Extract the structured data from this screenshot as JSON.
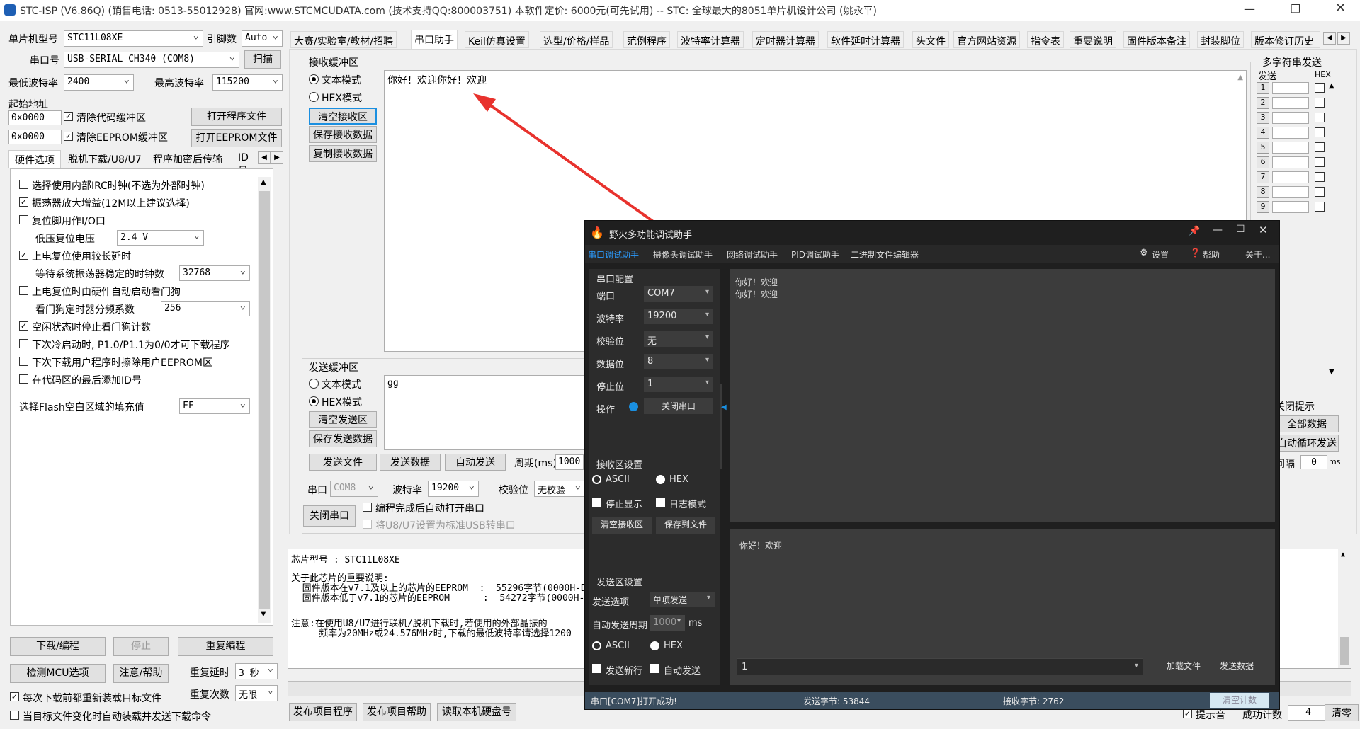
{
  "titlebar": {
    "text": "STC-ISP (V6.86Q) (销售电话: 0513-55012928) 官网:www.STCMCUDATA.com  (技术支持QQ:800003751) 本软件定价: 6000元(可先试用) -- STC: 全球最大的8051单片机设计公司 (姚永平)"
  },
  "left": {
    "mcu_label": "单片机型号",
    "mcu_value": "STC11L08XE",
    "pin_label": "引脚数",
    "pin_value": "Auto",
    "port_label": "串口号",
    "port_value": "USB-SERIAL CH340 (COM8)",
    "scan_button": "扫描",
    "min_baud_label": "最低波特率",
    "min_baud_value": "2400",
    "max_baud_label": "最高波特率",
    "max_baud_value": "115200",
    "start_addr_label": "起始地址",
    "addr1": "0x0000",
    "clear_code": "清除代码缓冲区",
    "open_program": "打开程序文件",
    "addr2": "0x0000",
    "clear_eeprom": "清除EEPROM缓冲区",
    "open_eeprom": "打开EEPROM文件",
    "tabs": [
      "硬件选项",
      "脱机下载/U8/U7",
      "程序加密后传输",
      "ID号"
    ],
    "options": [
      {
        "label": "选择使用内部IRC时钟(不选为外部时钟)",
        "checked": false
      },
      {
        "label": "振荡器放大增益(12M以上建议选择)",
        "checked": true
      },
      {
        "label": "复位脚用作I/O口",
        "checked": false
      },
      {
        "label": "低压复位电压",
        "value": "2.4 V"
      },
      {
        "label": "上电复位使用较长延时",
        "checked": true
      },
      {
        "label": "等待系统振荡器稳定的时钟数",
        "value": "32768"
      },
      {
        "label": "上电复位时由硬件自动启动看门狗",
        "checked": false
      },
      {
        "label": "看门狗定时器分频系数",
        "value": "256"
      },
      {
        "label": "空闲状态时停止看门狗计数",
        "checked": true
      },
      {
        "label": "下次冷启动时, P1.0/P1.1为0/0才可下载程序",
        "checked": false
      },
      {
        "label": "下次下载用户程序时擦除用户EEPROM区",
        "checked": false
      },
      {
        "label": "在代码区的最后添加ID号",
        "checked": false
      }
    ],
    "fill_label": "选择Flash空白区域的填充值",
    "fill_value": "FF",
    "download_button": "下载/编程",
    "stop_button": "停止",
    "reprogram_button": "重复编程",
    "detect_button": "检测MCU选项",
    "help_button": "注意/帮助",
    "repeat_delay_label": "重复延时",
    "repeat_delay_value": "3 秒",
    "repeat_count_label": "重复次数",
    "repeat_count_value": "无限",
    "reload_label": "每次下载前都重新装载目标文件",
    "auto_load_label": "当目标文件变化时自动装载并发送下载命令"
  },
  "tabs": [
    "大赛/实验室/教材/招聘",
    "串口助手",
    "Keil仿真设置",
    "选型/价格/样品",
    "范例程序",
    "波特率计算器",
    "定时器计算器",
    "软件延时计算器",
    "头文件",
    "官方网站资源",
    "指令表",
    "重要说明",
    "固件版本备注",
    "封装脚位",
    "版本修订历史"
  ],
  "serial": {
    "recv_title": "接收缓冲区",
    "text_mode": "文本模式",
    "hex_mode": "HEX模式",
    "clear_recv": "清空接收区",
    "save_recv": "保存接收数据",
    "copy_recv": "复制接收数据",
    "recv_content": "你好！欢迎你好！欢迎",
    "send_title": "发送缓冲区",
    "send_text_mode": "文本模式",
    "send_hex_mode": "HEX模式",
    "clear_send": "清空发送区",
    "save_send": "保存发送数据",
    "send_content": "gg",
    "send_file": "发送文件",
    "send_data": "发送数据",
    "auto_send": "自动发送",
    "period_label": "周期(ms)",
    "period_value": "1000",
    "port_label": "串口",
    "port_value": "COM8",
    "baud_label": "波特率",
    "baud_value": "19200",
    "parity_label": "校验位",
    "parity_value": "无校验",
    "close_port": "关闭串口",
    "auto_open": "编程完成后自动打开串口",
    "usb_convert": "将U8/U7设置为标准USB转串口"
  },
  "info": {
    "chip_line": "芯片型号 : STC11L08XE",
    "lines": [
      "关于此芯片的重要说明:",
      "  固件版本在v7.1及以上的芯片的EEPROM  :  55296字节(0000H-D",
      "  固件版本低于v7.1的芯片的EEPROM      :  54272字节(0000H-D",
      "",
      "注意:在使用U8/U7进行联机/脱机下载时,若使用的外部晶振的",
      "     频率为20MHz或24.576MHz时,下载的最低波特率请选择1200"
    ]
  },
  "bottom_buttons": [
    "发布项目程序",
    "发布项目帮助",
    "读取本机硬盘号"
  ],
  "multi": {
    "title": "多字符串发送",
    "send_header": "发送",
    "hex_header": "HEX",
    "rows": [
      "1",
      "2",
      "3",
      "4",
      "5",
      "6",
      "7",
      "8",
      "9"
    ],
    "close_hint": "关闭提示",
    "send_all": "全部数据",
    "loop_send": "自动循环发送",
    "interval_label": "间隔",
    "interval_value": "0",
    "ms": "ms",
    "hint_label": "提示音",
    "success_label": "成功计数",
    "success_value": "4",
    "clear_button": "清零"
  },
  "fire": {
    "title": "野火多功能调试助手",
    "tabs": [
      "串口调试助手",
      "摄像头调试助手",
      "网络调试助手",
      "PID调试助手",
      "二进制文件编辑器"
    ],
    "settings": "设置",
    "help": "帮助",
    "about": "关于...",
    "config_title": "串口配置",
    "port_label": "端口",
    "port_value": "COM7",
    "baud_label": "波特率",
    "baud_value": "19200",
    "parity_label": "校验位",
    "parity_value": "无",
    "databits_label": "数据位",
    "databits_value": "8",
    "stopbits_label": "停止位",
    "stopbits_value": "1",
    "op_label": "操作",
    "close_button": "关闭串口",
    "recv_title": "接收区设置",
    "ascii": "ASCII",
    "hex": "HEX",
    "stop_display": "停止显示",
    "log_mode": "日志模式",
    "clear_recv": "清空接收区",
    "save_file": "保存到文件",
    "send_title": "发送区设置",
    "send_option_label": "发送选项",
    "send_option_value": "单项发送",
    "auto_period_label": "自动发送周期",
    "auto_period_value": "1000",
    "ms": "ms",
    "send_ascii": "ASCII",
    "send_hex": "HEX",
    "newline": "发送新行",
    "auto_send": "自动发送",
    "recv_lines": [
      "你好！欢迎",
      "你好！欢迎"
    ],
    "send_text": "你好！欢迎",
    "input_value": "1",
    "load_file": "加载文件",
    "send_data": "发送数据",
    "status": "串口[COM7]打开成功!",
    "sent_bytes": "发送字节: 53844",
    "recv_bytes": "接收字节: 2762",
    "clear_count": "清空计数"
  },
  "colors": {
    "arrow": "#e8322d",
    "accent": "#1a8fe0"
  }
}
